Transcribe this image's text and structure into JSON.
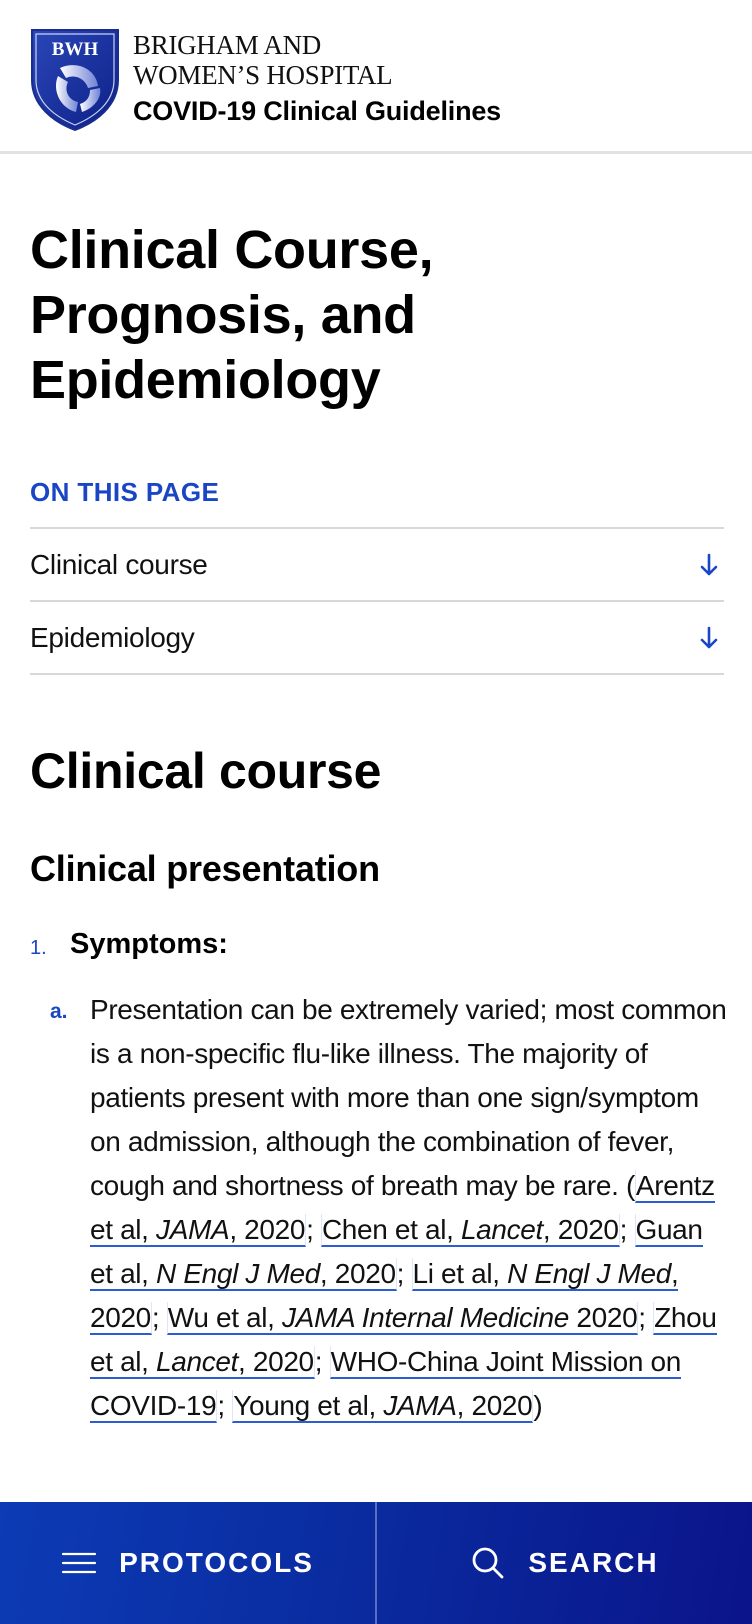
{
  "header": {
    "logo_text": "BWH",
    "brand_line_1": "BRIGHAM AND",
    "brand_line_2": "WOMEN’S HOSPITAL",
    "site_title": "COVID-19 Clinical Guidelines"
  },
  "page": {
    "title": "Clinical Course, Prognosis, and Epidemiology"
  },
  "toc": {
    "label": "ON THIS PAGE",
    "items": [
      {
        "label": "Clinical course",
        "icon": "arrow-down-icon"
      },
      {
        "label": "Epidemiology",
        "icon": "arrow-down-icon"
      }
    ]
  },
  "section": {
    "heading": "Clinical course",
    "subheading": "Clinical presentation",
    "list": [
      {
        "number": "1.",
        "title": "Symptoms:",
        "subitems": [
          {
            "letter": "a.",
            "text": "Presentation can be extremely varied; most common is a non-specific flu-like illness. The majority of patients present with more than one sign/symptom on admission, although the combination of fever, cough and shortness of breath may be rare. (",
            "citations": [
              {
                "authors": "Arentz et al, ",
                "journal": "JAMA",
                "year": ", 2020"
              },
              {
                "authors": "Chen et al, ",
                "journal": "Lancet",
                "year": ", 2020"
              },
              {
                "authors": "Guan et al, ",
                "journal": "N Engl J Med",
                "year": ", 2020"
              },
              {
                "authors": "Li et al, ",
                "journal": "N Engl J Med",
                "year": ", 2020"
              },
              {
                "authors": "Wu et al, ",
                "journal": "JAMA Internal Medicine",
                "year": " 2020"
              },
              {
                "authors": "Zhou et al, ",
                "journal": "Lancet",
                "year": ", 2020"
              },
              {
                "authors": "WHO-China Joint Mission on COVID-19",
                "journal": "",
                "year": ""
              },
              {
                "authors": "Young et al, ",
                "journal": "JAMA",
                "year": ", 2020"
              }
            ],
            "separator": "; ",
            "closing": ")"
          }
        ]
      }
    ]
  },
  "bottom_bar": {
    "protocols_label": "PROTOCOLS",
    "protocols_icon": "menu-icon",
    "search_label": "SEARCH",
    "search_icon": "search-icon"
  },
  "colors": {
    "accent": "#1a46c4",
    "bar_start": "#0c3bb5",
    "bar_end": "#0b148a",
    "link_underline": "#2d5bd0"
  }
}
